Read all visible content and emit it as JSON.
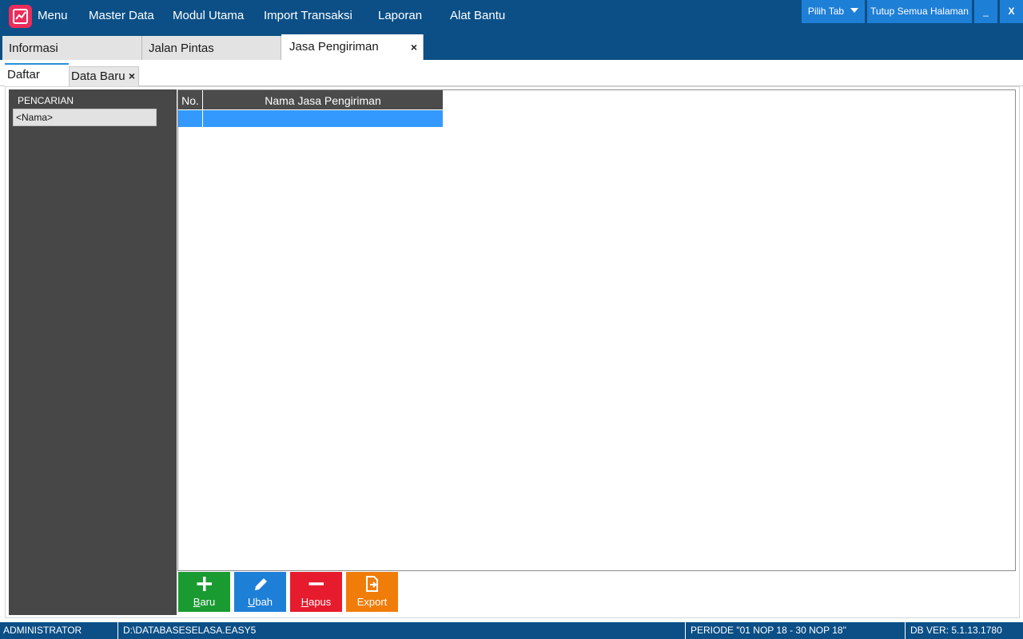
{
  "menubar": {
    "items": [
      "Menu",
      "Master Data",
      "Modul Utama",
      "Import Transaksi",
      "Laporan",
      "Alat Bantu"
    ],
    "pick_tab_label": "Pilih Tab",
    "close_all_label": "Tutup Semua Halaman",
    "minimize_label": "_",
    "close_label": "X"
  },
  "main_tabs": [
    {
      "label": "Informasi",
      "active": false,
      "closable": false
    },
    {
      "label": "Jalan Pintas",
      "active": false,
      "closable": false
    },
    {
      "label": "Jasa Pengiriman",
      "active": true,
      "closable": true
    }
  ],
  "tab_close_glyph": "×",
  "sub_tabs": [
    {
      "label": "Daftar",
      "active": true
    },
    {
      "label": "Data Baru",
      "active": false,
      "closable": true
    }
  ],
  "search": {
    "title": "PENCARIAN",
    "name_value": "<Nama>"
  },
  "grid": {
    "columns": [
      "No.",
      "Nama Jasa Pengiriman"
    ],
    "rows": [
      {
        "no": "",
        "nama": "",
        "selected": true
      }
    ]
  },
  "actions": [
    {
      "key": "baru",
      "mnemonic": "B",
      "rest": "aru",
      "color": "#1a9b32"
    },
    {
      "key": "ubah",
      "mnemonic": "U",
      "rest": "bah",
      "color": "#1e7fd6"
    },
    {
      "key": "hapus",
      "mnemonic": "H",
      "rest": "apus",
      "color": "#e61c2e"
    },
    {
      "key": "export",
      "mnemonic": "",
      "rest": "Export",
      "color": "#f07d0a"
    }
  ],
  "status": {
    "user": "ADMINISTRATOR",
    "database": "D:\\DATABASESELASA.EASY5",
    "periode": "PERIODE \"01 NOP 18 - 30 NOP 18\"",
    "db_version": "DB VER: 5.1.13.1780"
  },
  "colors": {
    "header_bg": "#0b4f86",
    "accent_blue": "#1e7fd6",
    "selected_row": "#3399ff",
    "panel_dark": "#474747",
    "logo": "#ec2c5a"
  }
}
